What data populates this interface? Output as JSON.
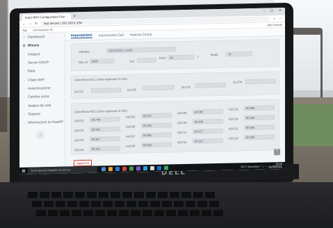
{
  "browser": {
    "tab_title": "Kwpi WiFi Configuration Pan",
    "new_tab": "+",
    "window_controls": "– ▢ ✕",
    "url": "Not secure | 192.168.4.1/fw",
    "bookmarks": [
      "App",
      "Connessione ID"
    ],
    "bookmarks_right": "Altri Preferiti"
  },
  "sidebar": {
    "items": [
      {
        "label": "Dashboard",
        "icon": "⌂"
      },
      {
        "label": "Misura",
        "icon": "◉",
        "active": true
      },
      {
        "label": "Hotspot",
        "icon": "◌"
      },
      {
        "label": "Server DHCP",
        "icon": "◌"
      },
      {
        "label": "Rete",
        "icon": "◌"
      },
      {
        "label": "Client WiFi",
        "icon": "◌"
      },
      {
        "label": "Autenticazione",
        "icon": "◌"
      },
      {
        "label": "Cambia icona",
        "icon": "◌"
      },
      {
        "label": "Vedere dei dati",
        "icon": "◌"
      },
      {
        "label": "Sistema",
        "icon": "◌"
      },
      {
        "label": "Informazioni su KwpiIP",
        "icon": "◌"
      }
    ],
    "collapse": "‹"
  },
  "content": {
    "tabs": [
      {
        "label": "Impostazioni",
        "active": true
      },
      {
        "label": "Inserimento Dati"
      },
      {
        "label": "Importa Dump"
      }
    ],
    "section1": {
      "fields": [
        {
          "label": "VIRABO",
          "value": "ZDS1234/A 1:1A2A"
        },
        {
          "label": "REL ID",
          "value": "9000"
        },
        {
          "label": "Ent",
          "value": ""
        },
        {
          "label": "Depli",
          "value": "4D"
        },
        {
          "label": "T",
          "value": ""
        },
        {
          "label": "Modb",
          "value": "70"
        }
      ]
    },
    "section2": {
      "title": "Grandezza DLC (zone espresse in mm)",
      "fields": [
        {
          "label": "DLC01",
          "value": ""
        },
        {
          "label": "DLC02",
          "value": ""
        },
        {
          "label": "DLC03",
          "value": ""
        },
        {
          "label": "DLC04",
          "value": ""
        }
      ]
    },
    "section3": {
      "title": "Grandezza ADC (zone espresse in mm)",
      "rows": [
        [
          {
            "label": "ADC01",
            "value": "80.748"
          },
          {
            "label": "ADC05",
            "value": "83.397"
          },
          {
            "label": "ADC09",
            "value": "80.080"
          },
          {
            "label": "ADC13",
            "value": "80.080"
          }
        ],
        [
          {
            "label": "ADC02",
            "value": "80.953"
          },
          {
            "label": "ADC06",
            "value": "80.991"
          },
          {
            "label": "ADC10",
            "value": "80.896"
          },
          {
            "label": "ADC14",
            "value": "80.596"
          }
        ],
        [
          {
            "label": "ADC03",
            "value": "80.817"
          },
          {
            "label": "ADC07",
            "value": "80.885"
          },
          {
            "label": "ADC11",
            "value": "80.077"
          },
          {
            "label": "ADC15",
            "value": "80.080"
          }
        ],
        [
          {
            "label": "ADC04",
            "value": "80.313"
          },
          {
            "label": "ADC08",
            "value": "80.819"
          },
          {
            "label": "ADC12",
            "value": "80.312"
          },
          {
            "label": "ADC16",
            "value": "80.080"
          }
        ]
      ]
    },
    "submit": "Aggiorna",
    "scroll_top": "⌃"
  },
  "taskbar": {
    "start": "⊞",
    "search": "Scrivi qui per eseguire la ricerca",
    "icons": [
      "#4a90d9",
      "#e8a73d",
      "#2f7bd1",
      "#d9453d",
      "#3f9d53",
      "#7a5cd1",
      "#2aa7d8",
      "#d9d9d9",
      "#1f6fd1",
      "#39a85c"
    ],
    "tray": "28°C Nuvoloso ^ ⌂ ◔",
    "time": "13:44",
    "date": "21/09/2021"
  },
  "brand": "DELL"
}
